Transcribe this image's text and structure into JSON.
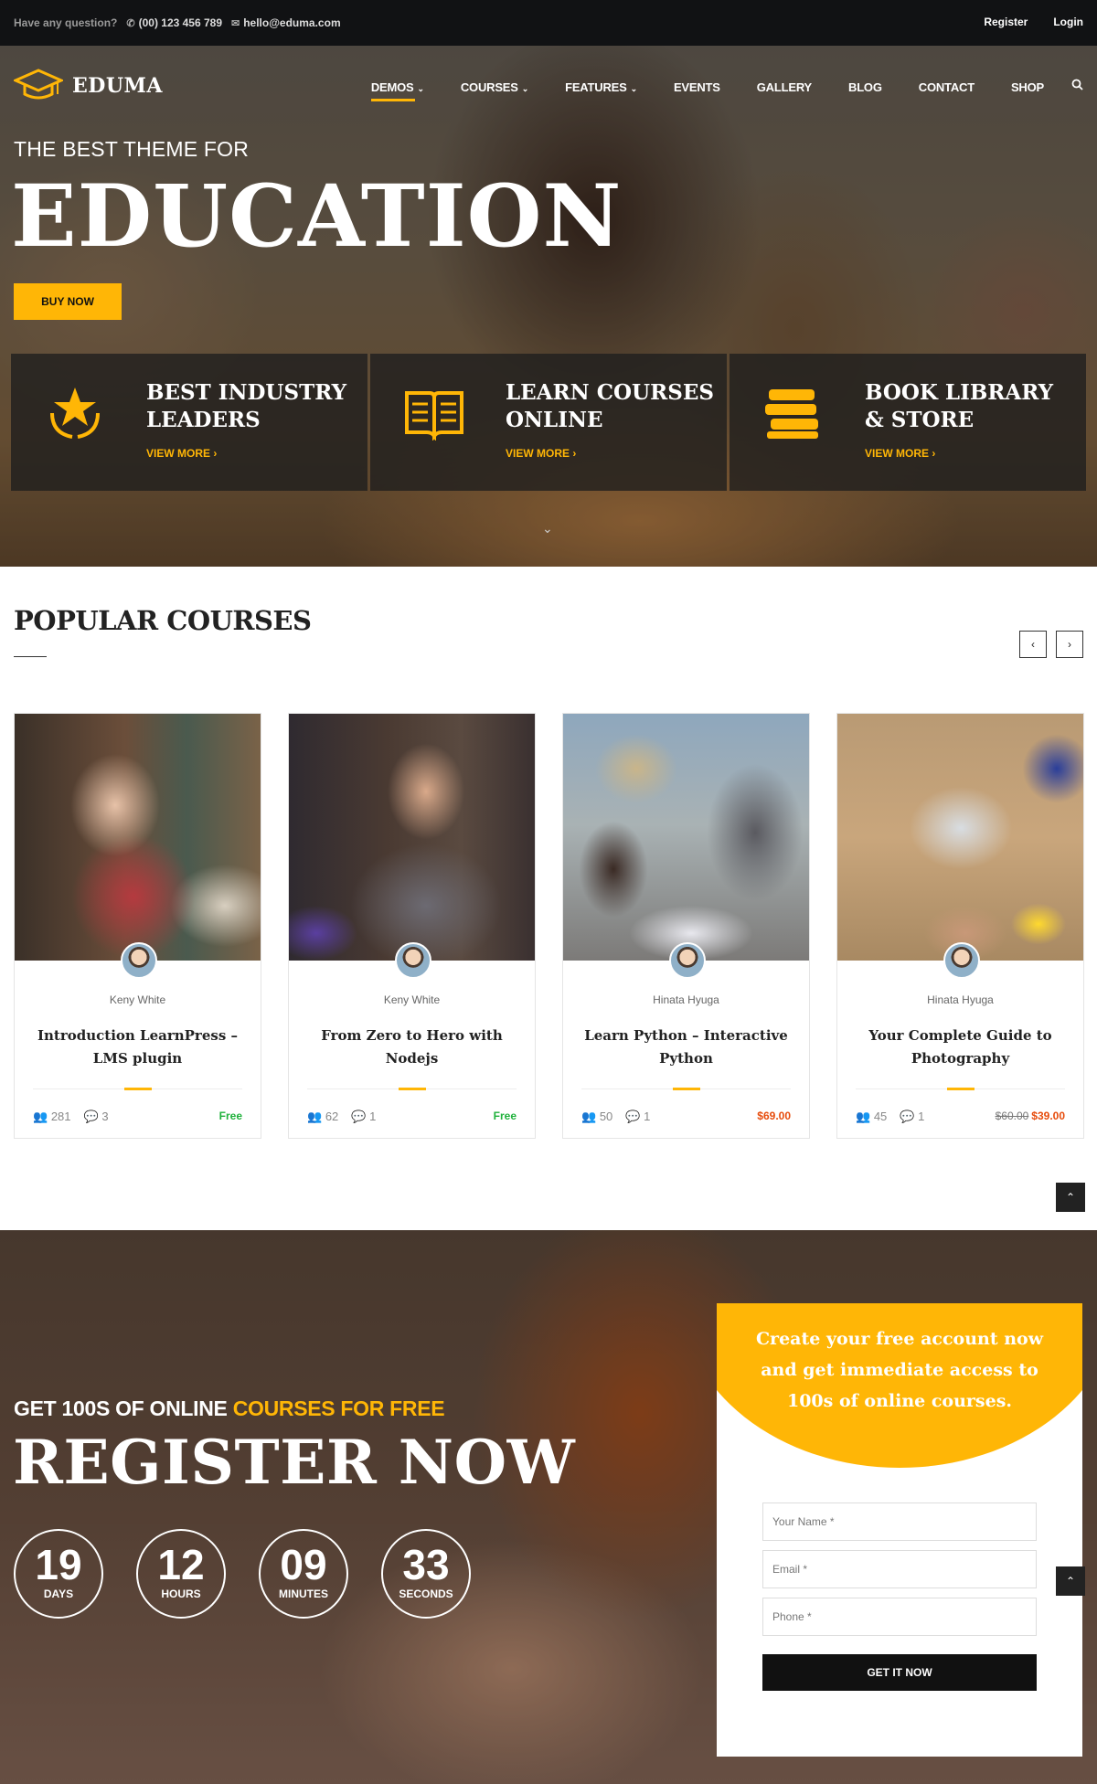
{
  "topbar": {
    "question": "Have any question?",
    "phone": "(00) 123 456 789",
    "email": "hello@eduma.com",
    "register": "Register",
    "login": "Login"
  },
  "logo": {
    "name": "EDUMA"
  },
  "nav": {
    "items": [
      {
        "label": "DEMOS",
        "dropdown": true,
        "active": true
      },
      {
        "label": "COURSES",
        "dropdown": true
      },
      {
        "label": "FEATURES",
        "dropdown": true
      },
      {
        "label": "EVENTS"
      },
      {
        "label": "GALLERY"
      },
      {
        "label": "BLOG"
      },
      {
        "label": "CONTACT"
      },
      {
        "label": "SHOP"
      }
    ],
    "search_icon": "search-icon"
  },
  "hero": {
    "subtitle": "THE BEST THEME FOR",
    "title": "EDUCATION",
    "button": "BUY NOW",
    "features": [
      {
        "icon": "award-star-icon",
        "title": "BEST INDUSTRY LEADERS",
        "link": "VIEW MORE ›"
      },
      {
        "icon": "open-book-icon",
        "title": "LEARN COURSES ONLINE",
        "link": "VIEW MORE ›"
      },
      {
        "icon": "book-stack-icon",
        "title": "BOOK LIBRARY & STORE",
        "link": "VIEW MORE ›"
      }
    ]
  },
  "popular": {
    "title": "POPULAR COURSES",
    "courses": [
      {
        "author": "Keny White",
        "title": "Introduction LearnPress – LMS plugin",
        "students": "281",
        "comments": "3",
        "price": "Free",
        "old_price": ""
      },
      {
        "author": "Keny White",
        "title": "From Zero to Hero with Nodejs",
        "students": "62",
        "comments": "1",
        "price": "Free",
        "old_price": ""
      },
      {
        "author": "Hinata Hyuga",
        "title": "Learn Python – Interactive Python",
        "students": "50",
        "comments": "1",
        "price": "$69.00",
        "old_price": ""
      },
      {
        "author": "Hinata Hyuga",
        "title": "Your Complete Guide to Photography",
        "students": "45",
        "comments": "1",
        "price": "$39.00",
        "old_price": "$60.00"
      }
    ]
  },
  "register": {
    "subtitle_a": "GET 100S OF ONLINE ",
    "subtitle_b": "COURSES FOR FREE",
    "title": "REGISTER NOW",
    "countdown": [
      {
        "value": "19",
        "label": "DAYS"
      },
      {
        "value": "12",
        "label": "HOURS"
      },
      {
        "value": "09",
        "label": "MINUTES"
      },
      {
        "value": "33",
        "label": "SECONDS"
      }
    ],
    "form": {
      "headline": "Create your free account now and get immediate access to 100s of online courses.",
      "name_placeholder": "Your Name *",
      "email_placeholder": "Email *",
      "phone_placeholder": "Phone *",
      "submit": "GET IT NOW"
    }
  },
  "colors": {
    "accent": "#ffb606",
    "dark": "#111214",
    "free": "#1fb13b",
    "price": "#e74c0c"
  }
}
